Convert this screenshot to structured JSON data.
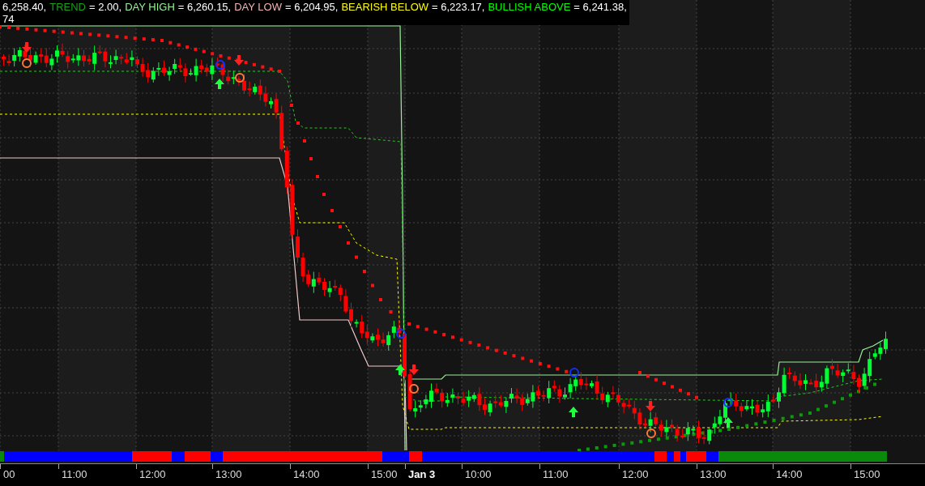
{
  "header": {
    "readings": [
      {
        "value": "6,258.40,"
      },
      {
        "label": "TREND",
        "value": "= 2.00,",
        "color": "#1aa01a"
      },
      {
        "label": "DAY HIGH",
        "value": "= 6,260.15,",
        "color": "#98f098"
      },
      {
        "label": "DAY LOW",
        "value": "= 6,204.95,",
        "color": "#f0b4b4"
      },
      {
        "label": "BEARISH BELOW",
        "value": "= 6,223.17,",
        "color": "#ffff00"
      },
      {
        "label": "BULLISH ABOVE",
        "value": "= 6,241.38,",
        "color": "#00ff00"
      }
    ],
    "second_line": "74"
  },
  "time_axis": [
    {
      "label": "00",
      "kind": "time"
    },
    {
      "label": "11:00",
      "kind": "time"
    },
    {
      "label": "12:00",
      "kind": "time"
    },
    {
      "label": "13:00",
      "kind": "time"
    },
    {
      "label": "14:00",
      "kind": "time"
    },
    {
      "label": "15:00",
      "kind": "time"
    },
    {
      "label": "Jan 3",
      "kind": "date"
    },
    {
      "label": "10:00",
      "kind": "time"
    },
    {
      "label": "11:00",
      "kind": "time"
    },
    {
      "label": "12:00",
      "kind": "time"
    },
    {
      "label": "13:00",
      "kind": "time"
    },
    {
      "label": "14:00",
      "kind": "time"
    },
    {
      "label": "15:00",
      "kind": "time"
    }
  ]
}
